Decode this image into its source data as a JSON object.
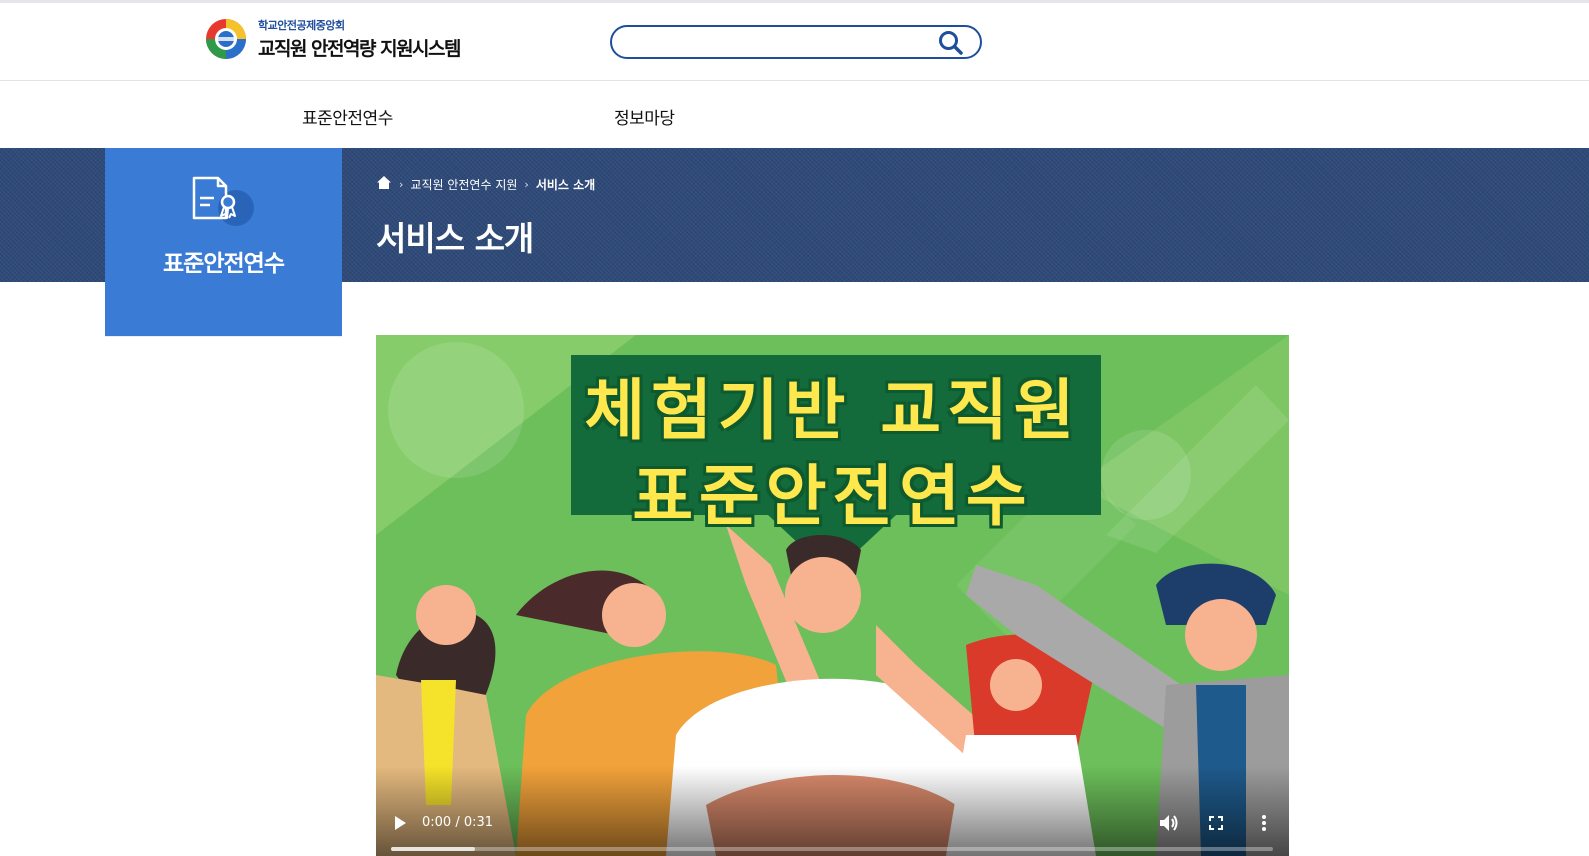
{
  "header": {
    "org_name": "학교안전공제중앙회",
    "system_name": "교직원 안전역량 지원시스템",
    "search": {
      "value": "",
      "placeholder": ""
    },
    "search_icon": "search-icon"
  },
  "nav": {
    "items": [
      {
        "label": "표준안전연수"
      },
      {
        "label": "정보마당"
      }
    ]
  },
  "sidebar": {
    "title": "표준안전연수",
    "icon": "certificate-icon",
    "color": "#3a7bd5"
  },
  "breadcrumb": {
    "home_icon": "home-icon",
    "items": [
      {
        "label": "교직원 안전연수 지원"
      },
      {
        "label": "서비스 소개"
      }
    ]
  },
  "page": {
    "title": "서비스 소개"
  },
  "video": {
    "title_line1": "체험기반 교직원",
    "title_line2": "표준안전연수",
    "time": "0:00 / 0:31",
    "buffered": 0.095,
    "played": 0.0
  },
  "colors": {
    "banner": "#2e4a78",
    "accent": "#1f4e9c",
    "video_bg": "#6cbf5a",
    "video_title": "#ffe84d",
    "video_title_outline": "#0e5a2f"
  }
}
